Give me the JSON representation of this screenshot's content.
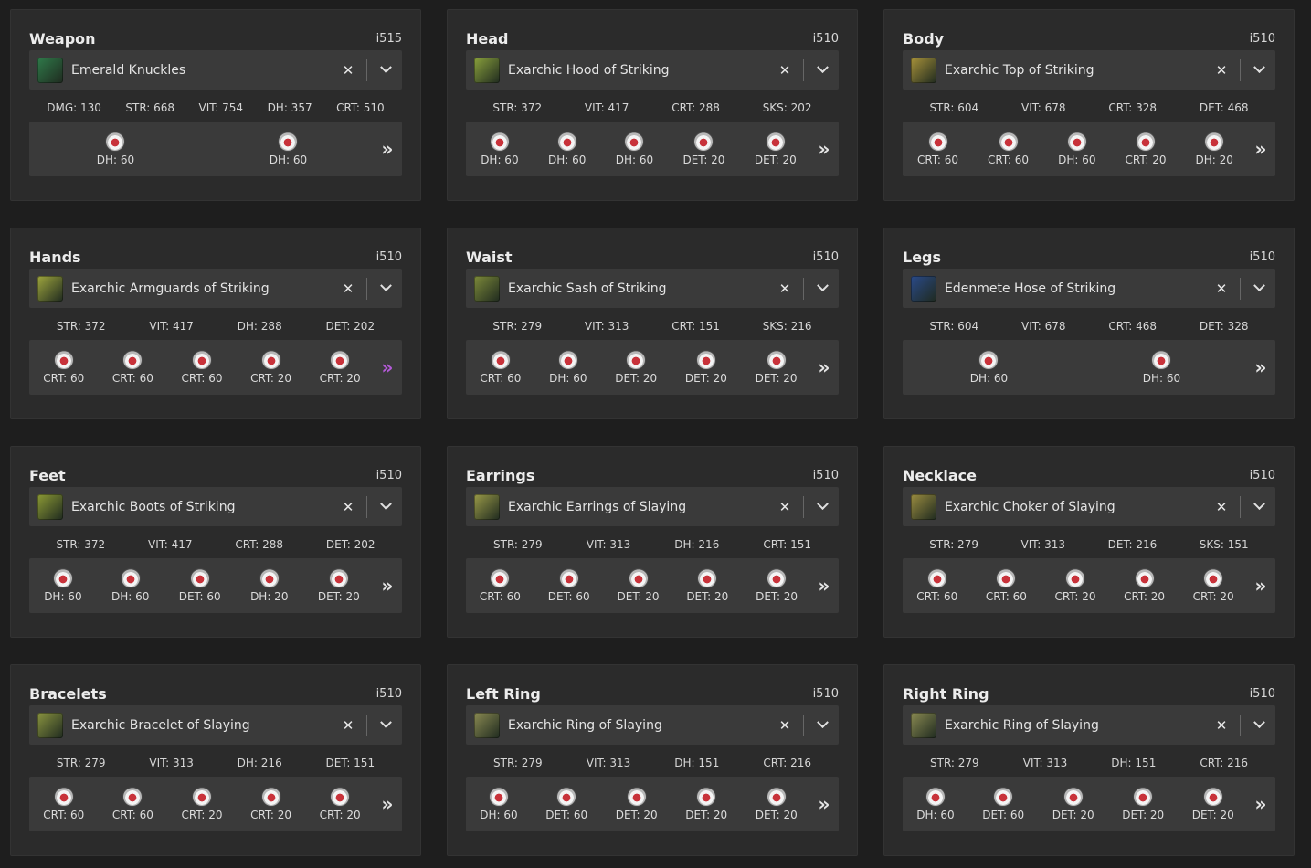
{
  "slots": [
    {
      "title": "Weapon",
      "ilvl": "i515",
      "item": "Emerald Knuckles",
      "icon_color": "#2f7a4a",
      "stats": [
        "DMG: 130",
        "STR: 668",
        "VIT: 754",
        "DH: 357",
        "CRT: 510"
      ],
      "materia": [
        "DH: 60",
        "DH: 60"
      ],
      "expand_glyph": "»"
    },
    {
      "title": "Head",
      "ilvl": "i510",
      "item": "Exarchic Hood of Striking",
      "icon_color": "#8aa13c",
      "stats": [
        "STR: 372",
        "VIT: 417",
        "CRT: 288",
        "SKS: 202"
      ],
      "materia": [
        "DH: 60",
        "DH: 60",
        "DH: 60",
        "DET: 20",
        "DET: 20"
      ],
      "expand_glyph": "»"
    },
    {
      "title": "Body",
      "ilvl": "i510",
      "item": "Exarchic Top of Striking",
      "icon_color": "#a8923a",
      "stats": [
        "STR: 604",
        "VIT: 678",
        "CRT: 328",
        "DET: 468"
      ],
      "materia": [
        "CRT: 60",
        "CRT: 60",
        "DH: 60",
        "CRT: 20",
        "DH: 20"
      ],
      "expand_glyph": "»"
    },
    {
      "title": "Hands",
      "ilvl": "i510",
      "item": "Exarchic Armguards of Striking",
      "icon_color": "#9fa63e",
      "stats": [
        "STR: 372",
        "VIT: 417",
        "DH: 288",
        "DET: 202"
      ],
      "materia": [
        "CRT: 60",
        "CRT: 60",
        "CRT: 60",
        "CRT: 20",
        "CRT: 20"
      ],
      "expand_glyph": "»",
      "expand_purple": true
    },
    {
      "title": "Waist",
      "ilvl": "i510",
      "item": "Exarchic Sash of Striking",
      "icon_color": "#7d8a3a",
      "stats": [
        "STR: 279",
        "VIT: 313",
        "CRT: 151",
        "SKS: 216"
      ],
      "materia": [
        "CRT: 60",
        "DH: 60",
        "DET: 20",
        "DET: 20",
        "DET: 20"
      ],
      "expand_glyph": "»"
    },
    {
      "title": "Legs",
      "ilvl": "i510",
      "item": "Edenmete Hose of Striking",
      "icon_color": "#2a4a8a",
      "stats": [
        "STR: 604",
        "VIT: 678",
        "CRT: 468",
        "DET: 328"
      ],
      "materia": [
        "DH: 60",
        "DH: 60"
      ],
      "expand_glyph": "»"
    },
    {
      "title": "Feet",
      "ilvl": "i510",
      "item": "Exarchic Boots of Striking",
      "icon_color": "#8c9a35",
      "stats": [
        "STR: 372",
        "VIT: 417",
        "CRT: 288",
        "DET: 202"
      ],
      "materia": [
        "DH: 60",
        "DH: 60",
        "DET: 60",
        "DH: 20",
        "DET: 20"
      ],
      "expand_glyph": "»"
    },
    {
      "title": "Earrings",
      "ilvl": "i510",
      "item": "Exarchic Earrings of Slaying",
      "icon_color": "#9a9a48",
      "stats": [
        "STR: 279",
        "VIT: 313",
        "DH: 216",
        "CRT: 151"
      ],
      "materia": [
        "CRT: 60",
        "DET: 60",
        "DET: 20",
        "DET: 20",
        "DET: 20"
      ],
      "expand_glyph": "»"
    },
    {
      "title": "Necklace",
      "ilvl": "i510",
      "item": "Exarchic Choker of Slaying",
      "icon_color": "#9a8c40",
      "stats": [
        "STR: 279",
        "VIT: 313",
        "DET: 216",
        "SKS: 151"
      ],
      "materia": [
        "CRT: 60",
        "CRT: 60",
        "CRT: 20",
        "CRT: 20",
        "CRT: 20"
      ],
      "expand_glyph": "»"
    },
    {
      "title": "Bracelets",
      "ilvl": "i510",
      "item": "Exarchic Bracelet of Slaying",
      "icon_color": "#8a9440",
      "stats": [
        "STR: 279",
        "VIT: 313",
        "DH: 216",
        "DET: 151"
      ],
      "materia": [
        "CRT: 60",
        "CRT: 60",
        "CRT: 20",
        "CRT: 20",
        "CRT: 20"
      ],
      "expand_glyph": "»"
    },
    {
      "title": "Left Ring",
      "ilvl": "i510",
      "item": "Exarchic Ring of Slaying",
      "icon_color": "#8a8a52",
      "stats": [
        "STR: 279",
        "VIT: 313",
        "DH: 151",
        "CRT: 216"
      ],
      "materia": [
        "DH: 60",
        "DET: 60",
        "DET: 20",
        "DET: 20",
        "DET: 20"
      ],
      "expand_glyph": "»"
    },
    {
      "title": "Right Ring",
      "ilvl": "i510",
      "item": "Exarchic Ring of Slaying",
      "icon_color": "#8a8a52",
      "stats": [
        "STR: 279",
        "VIT: 313",
        "DH: 151",
        "CRT: 216"
      ],
      "materia": [
        "DH: 60",
        "DET: 60",
        "DET: 20",
        "DET: 20",
        "DET: 20"
      ],
      "expand_glyph": "»"
    }
  ],
  "clear_glyph": "✕"
}
